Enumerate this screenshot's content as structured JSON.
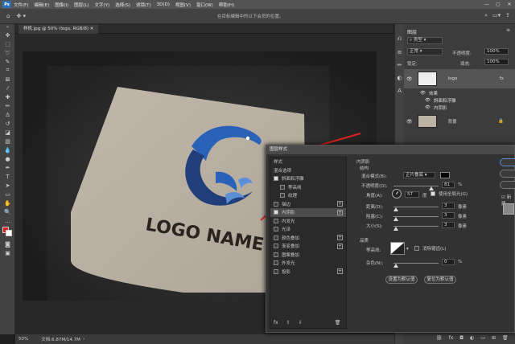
{
  "menubar": {
    "app_icon": "Ps",
    "items": [
      "文件(F)",
      "编辑(E)",
      "图像(I)",
      "图层(L)",
      "文字(Y)",
      "选择(S)",
      "滤镜(T)",
      "3D(D)",
      "视图(V)",
      "窗口(W)",
      "帮助(H)"
    ],
    "window_controls": [
      "—",
      "▢",
      "✕"
    ]
  },
  "options_bar": {
    "hint": "在目标编辑中的以下会员的位置。",
    "right_icons": [
      "search-icon",
      "workspace-icon",
      "share-icon"
    ]
  },
  "document": {
    "tab_label": "样机.jpg @ 50% (logo, RGB/8)",
    "logo_text": "LOGO NAME",
    "zoom": "50%",
    "status": "文档:6.87M/14.7M"
  },
  "layers_panel": {
    "tab": "图层",
    "kind_label": "类型",
    "blend_mode": "正常",
    "opacity_label": "不透明度:",
    "opacity_value": "100%",
    "lock_label": "锁定:",
    "fill_label": "填充:",
    "fill_value": "100%",
    "layers": [
      {
        "name": "logo",
        "fx": "fx"
      },
      {
        "name": "效果"
      },
      {
        "name": "斜面和浮雕"
      },
      {
        "name": "内阴影"
      },
      {
        "name": "背景"
      }
    ]
  },
  "dialog": {
    "title": "图层样式",
    "styles_header": "样式",
    "blend_options": "混合选项",
    "styles": [
      {
        "label": "斜面和浮雕",
        "checked": true,
        "plus": false
      },
      {
        "label": "等高线",
        "checked": false,
        "plus": false
      },
      {
        "label": "纹理",
        "checked": false,
        "plus": false
      },
      {
        "label": "描边",
        "checked": false,
        "plus": true
      },
      {
        "label": "内阴影",
        "checked": true,
        "plus": true
      },
      {
        "label": "内发光",
        "checked": false,
        "plus": false
      },
      {
        "label": "光泽",
        "checked": false,
        "plus": false
      },
      {
        "label": "颜色叠加",
        "checked": false,
        "plus": true
      },
      {
        "label": "渐变叠加",
        "checked": false,
        "plus": true
      },
      {
        "label": "图案叠加",
        "checked": false,
        "plus": false
      },
      {
        "label": "外发光",
        "checked": false,
        "plus": false
      },
      {
        "label": "投影",
        "checked": false,
        "plus": true
      }
    ],
    "section_title": "内阴影",
    "structure": "结构",
    "blend_mode_label": "混合模式(B):",
    "blend_mode_value": "正片叠底",
    "opacity_label": "不透明度(O):",
    "opacity_value": "81",
    "angle_label": "角度(A):",
    "angle_value": "57",
    "angle_unit": "度",
    "global_light": "使用全局光(G)",
    "distance_label": "距离(D):",
    "distance_value": "3",
    "choke_label": "阻塞(C):",
    "choke_value": "3",
    "size_label": "大小(S):",
    "size_value": "3",
    "px": "像素",
    "percent": "%",
    "quality": "品质",
    "contour_label": "等高线:",
    "anti_alias": "消除锯齿(L)",
    "noise_label": "杂色(N):",
    "noise_value": "0",
    "btn_default": "设置为默认值",
    "btn_reset": "复位为默认值",
    "side_buttons": [
      "",
      "",
      "",
      "新建"
    ]
  },
  "colors": {
    "accent_red": "#e02020",
    "logo_blue": "#2a62b8",
    "logo_dark": "#1f3e7a"
  }
}
